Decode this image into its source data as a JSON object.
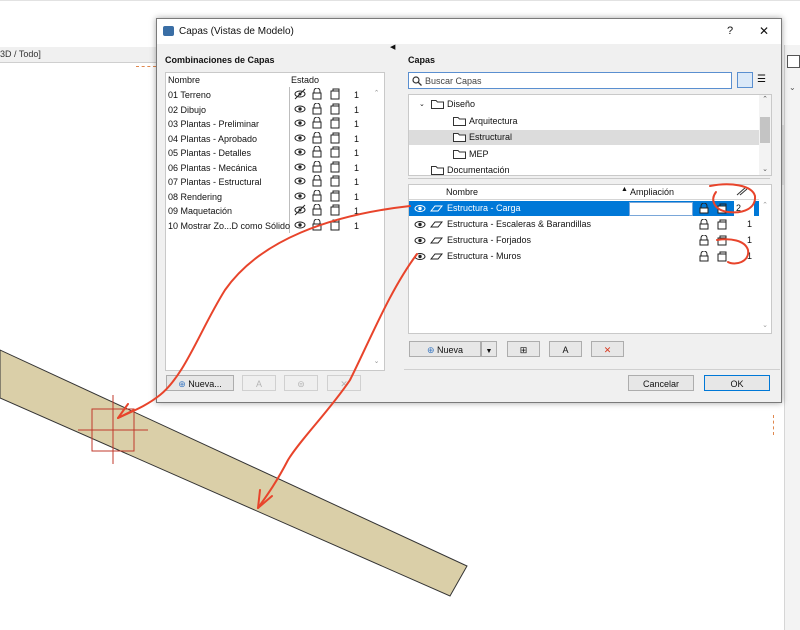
{
  "app": {
    "view_tab_label": "3D / Todo]"
  },
  "dialog": {
    "title": "Capas (Vistas de Modelo)",
    "help_label": "?",
    "close_label": "✕",
    "ok_label": "OK",
    "cancel_label": "Cancelar"
  },
  "combos": {
    "title": "Combinaciones de Capas",
    "col_name": "Nombre",
    "col_state": "Estado",
    "items": [
      {
        "name": "01 Terreno",
        "count": "1",
        "eye": "hidden"
      },
      {
        "name": "02 Dibujo",
        "count": "1",
        "eye": "visible"
      },
      {
        "name": "03 Plantas - Preliminar",
        "count": "1",
        "eye": "visible"
      },
      {
        "name": "04 Plantas - Aprobado",
        "count": "1",
        "eye": "visible"
      },
      {
        "name": "05 Plantas - Detalles",
        "count": "1",
        "eye": "visible"
      },
      {
        "name": "06 Plantas - Mecánica",
        "count": "1",
        "eye": "visible"
      },
      {
        "name": "07 Plantas - Estructural",
        "count": "1",
        "eye": "visible"
      },
      {
        "name": "08 Rendering",
        "count": "1",
        "eye": "visible"
      },
      {
        "name": "09 Maquetación",
        "count": "1",
        "eye": "hidden"
      },
      {
        "name": "10 Mostrar Zo...D como Sólido",
        "count": "1",
        "eye": "visible"
      }
    ],
    "new_button": "Nueva..."
  },
  "layers": {
    "title": "Capas",
    "search_placeholder": "Buscar Capas",
    "tree": [
      {
        "label": "Diseño",
        "level": 1,
        "expanded": true
      },
      {
        "label": "Arquitectura",
        "level": 2
      },
      {
        "label": "Estructural",
        "level": 2,
        "selected": true
      },
      {
        "label": "MEP",
        "level": 2
      },
      {
        "label": "Documentación",
        "level": 1
      }
    ],
    "col_name": "Nombre",
    "col_extension": "Ampliación",
    "rows": [
      {
        "name": "Estructura - Carga",
        "number": "2",
        "selected": true
      },
      {
        "name": "Estructura - Escaleras & Barandillas",
        "number": "1"
      },
      {
        "name": "Estructura - Forjados",
        "number": "1"
      },
      {
        "name": "Estructura - Muros",
        "number": "1"
      }
    ],
    "new_button": "Nueva"
  },
  "colors": {
    "selection": "#0078d7",
    "beam_fill": "#dacfa8",
    "annotation_red": "#e8442b",
    "tree_selected": "#dcdcdc"
  }
}
